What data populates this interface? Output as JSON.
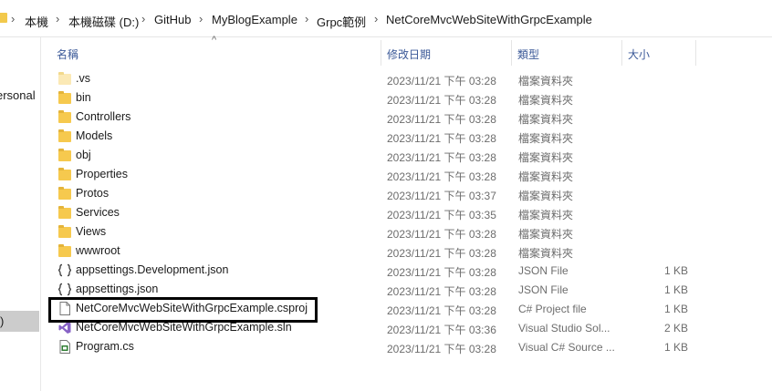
{
  "breadcrumb": [
    "本機",
    "本機磁碟 (D:)",
    "GitHub",
    "MyBlogExample",
    "Grpc範例",
    "NetCoreMvcWebSiteWithGrpcExample"
  ],
  "nav": {
    "item_personal": "ersonal",
    "item_selected": ")"
  },
  "columns": {
    "name": "名稱",
    "date": "修改日期",
    "type": "類型",
    "size": "大小"
  },
  "files": [
    {
      "name": ".vs",
      "date": "2023/11/21 下午 03:28",
      "type": "檔案資料夾",
      "size": "",
      "icon": "folder-hidden-icon"
    },
    {
      "name": "bin",
      "date": "2023/11/21 下午 03:28",
      "type": "檔案資料夾",
      "size": "",
      "icon": "folder-icon"
    },
    {
      "name": "Controllers",
      "date": "2023/11/21 下午 03:28",
      "type": "檔案資料夾",
      "size": "",
      "icon": "folder-icon"
    },
    {
      "name": "Models",
      "date": "2023/11/21 下午 03:28",
      "type": "檔案資料夾",
      "size": "",
      "icon": "folder-icon"
    },
    {
      "name": "obj",
      "date": "2023/11/21 下午 03:28",
      "type": "檔案資料夾",
      "size": "",
      "icon": "folder-icon"
    },
    {
      "name": "Properties",
      "date": "2023/11/21 下午 03:28",
      "type": "檔案資料夾",
      "size": "",
      "icon": "folder-icon"
    },
    {
      "name": "Protos",
      "date": "2023/11/21 下午 03:37",
      "type": "檔案資料夾",
      "size": "",
      "icon": "folder-icon"
    },
    {
      "name": "Services",
      "date": "2023/11/21 下午 03:35",
      "type": "檔案資料夾",
      "size": "",
      "icon": "folder-icon"
    },
    {
      "name": "Views",
      "date": "2023/11/21 下午 03:28",
      "type": "檔案資料夾",
      "size": "",
      "icon": "folder-icon"
    },
    {
      "name": "wwwroot",
      "date": "2023/11/21 下午 03:28",
      "type": "檔案資料夾",
      "size": "",
      "icon": "folder-icon"
    },
    {
      "name": "appsettings.Development.json",
      "date": "2023/11/21 下午 03:28",
      "type": "JSON File",
      "size": "1 KB",
      "icon": "json-file-icon"
    },
    {
      "name": "appsettings.json",
      "date": "2023/11/21 下午 03:28",
      "type": "JSON File",
      "size": "1 KB",
      "icon": "json-file-icon"
    },
    {
      "name": "NetCoreMvcWebSiteWithGrpcExample.csproj",
      "date": "2023/11/21 下午 03:28",
      "type": "C# Project file",
      "size": "1 KB",
      "icon": "file-icon"
    },
    {
      "name": "NetCoreMvcWebSiteWithGrpcExample.sln",
      "date": "2023/11/21 下午 03:36",
      "type": "Visual Studio Sol...",
      "size": "2 KB",
      "icon": "visual-studio-solution-icon"
    },
    {
      "name": "Program.cs",
      "date": "2023/11/21 下午 03:28",
      "type": "Visual C# Source ...",
      "size": "1 KB",
      "icon": "csharp-file-icon"
    }
  ],
  "colors": {
    "header_text": "#3b5998",
    "folder": "#f6c94e",
    "selected_nav": "#cccccc",
    "highlight_border": "#000000"
  }
}
